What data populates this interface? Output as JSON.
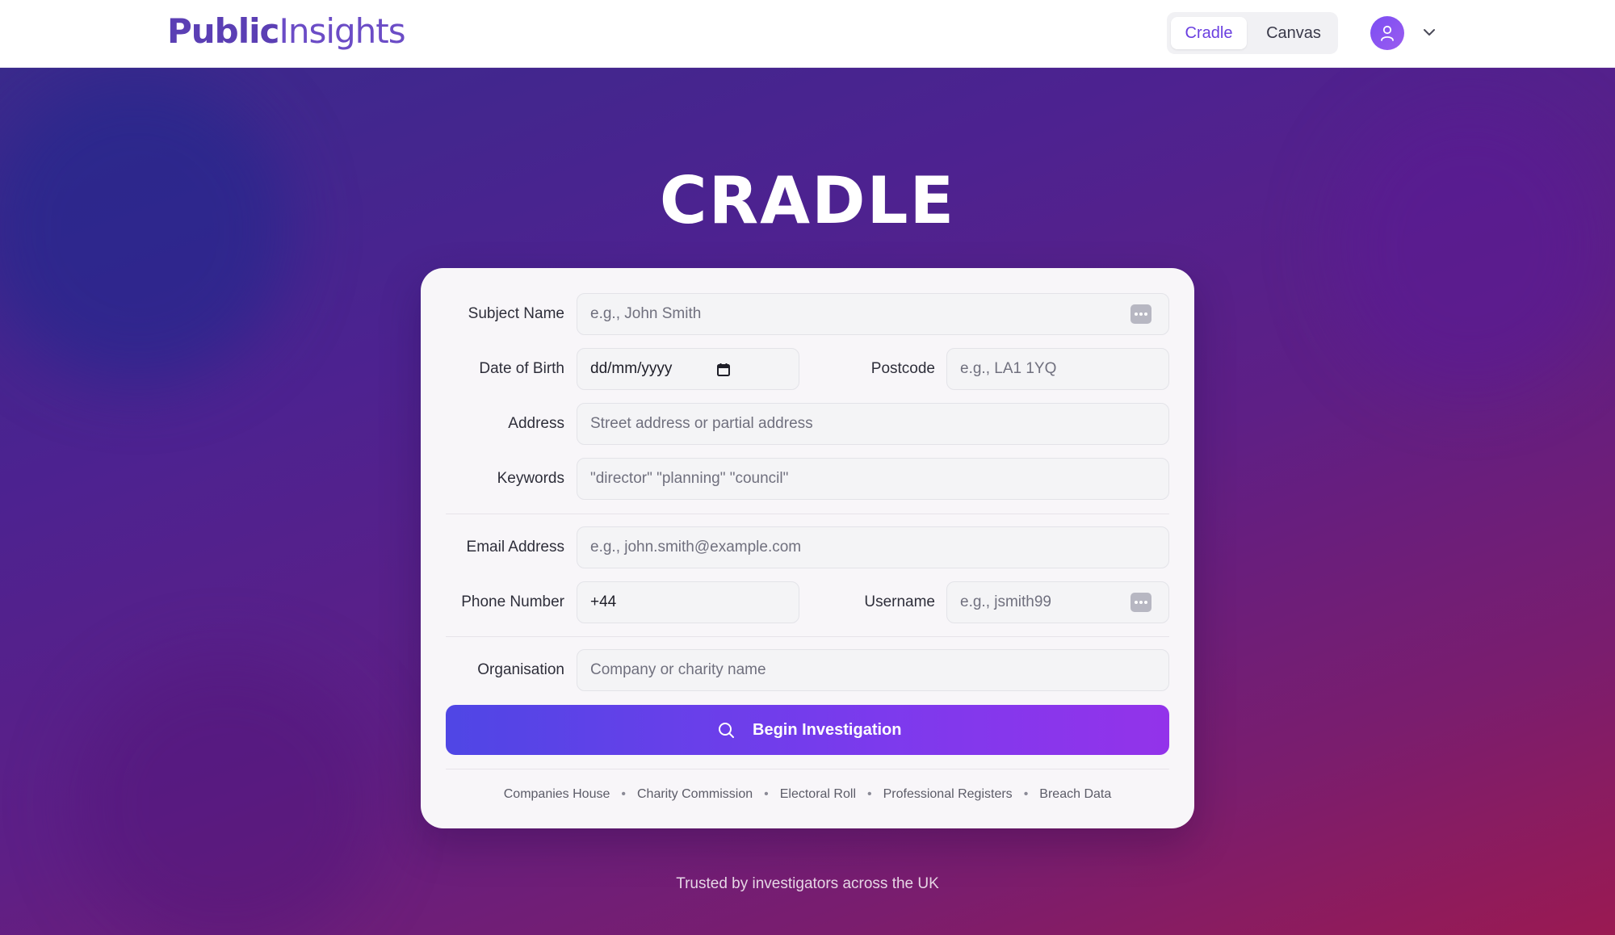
{
  "header": {
    "logo_part1": "Public",
    "logo_part2": "Insights",
    "tabs": [
      {
        "label": "Cradle",
        "active": true
      },
      {
        "label": "Canvas",
        "active": false
      }
    ],
    "user_icon": "user-icon",
    "menu_icon": "chevron-down-icon"
  },
  "main": {
    "title": "CRADLE",
    "form": {
      "subject_name": {
        "label": "Subject Name",
        "placeholder": "e.g., John Smith"
      },
      "date_of_birth": {
        "label": "Date of Birth",
        "value": "dd/mm/yyyy"
      },
      "postcode": {
        "label": "Postcode",
        "placeholder": "e.g., LA1 1YQ"
      },
      "address": {
        "label": "Address",
        "placeholder": "Street address or partial address"
      },
      "keywords": {
        "label": "Keywords",
        "placeholder": "\"director\" \"planning\" \"council\""
      },
      "email": {
        "label": "Email Address",
        "placeholder": "e.g., john.smith@example.com"
      },
      "phone": {
        "label": "Phone Number",
        "value": "+44"
      },
      "username": {
        "label": "Username",
        "placeholder": "e.g., jsmith99"
      },
      "organisation": {
        "label": "Organisation",
        "placeholder": "Company or charity name"
      },
      "submit_label": "Begin Investigation"
    },
    "sources": [
      "Companies House",
      "Charity Commission",
      "Electoral Roll",
      "Professional Registers",
      "Breach Data"
    ],
    "sources_separator": "•",
    "tagline": "Trusted by investigators across the UK"
  },
  "colors": {
    "brand": "#5b3fb4",
    "accent": "#6a3fe0",
    "cta_start": "#4f46e5",
    "cta_end": "#9333ea"
  }
}
